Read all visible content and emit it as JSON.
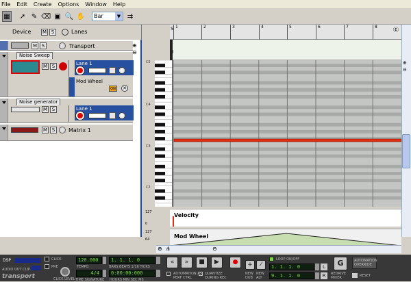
{
  "menu": [
    "File",
    "Edit",
    "Create",
    "Options",
    "Window",
    "Help"
  ],
  "toolbar": {
    "snap_value": "Bar"
  },
  "devhead": {
    "device_label": "Device",
    "m": "M",
    "s": "S",
    "lanes_label": "Lanes"
  },
  "tracks": {
    "transport": {
      "name": "Transport"
    },
    "noise_sweep": {
      "tab": "Noise Sweep",
      "lane": "Lane 1",
      "mod": "Mod Wheel",
      "on": "ON"
    },
    "noise_gen": {
      "tab": "Noise generator",
      "lane": "Lane 1"
    },
    "matrix": {
      "name": "Matrix 1"
    }
  },
  "ruler": {
    "bars": [
      "1",
      "2",
      "3",
      "4",
      "5",
      "6",
      "7",
      "8"
    ]
  },
  "keys": {
    "labels": [
      "C5",
      "C4",
      "C3",
      "C2"
    ]
  },
  "velocity": {
    "label": "Velocity",
    "max": "127",
    "min": "0"
  },
  "modwheel": {
    "label": "Mod Wheel",
    "max": "127",
    "mid": "64"
  },
  "transport": {
    "dsp": "DSP",
    "audio_out": "AUDIO OUT CLIP",
    "brand": "transport",
    "click": "CLICK",
    "pre": "PRE",
    "click_level": "CLICK LEVEL",
    "tempo": "120.000",
    "tempo_label": "TEMPO",
    "sig": "4/4",
    "sig_label": "TIME SIGNATURE",
    "pos": "1.  1.  1.   0",
    "pos_label": "BARS BEATS 1/16 TICKS",
    "time": "0:00:00:000",
    "time_label": "HOURS  MIN  SEC  MS",
    "auto_perf": "AUTOMATION AS PERF CTRL",
    "quantize": "QUANTIZE DURING REC",
    "new_dub": "NEW DUB",
    "new_alt": "NEW ALT",
    "loop": "LOOP ON/OFF",
    "loop_l": "1.  1.  1.   0",
    "loop_r": "9.  1.  1.   0",
    "l": "L",
    "r": "R",
    "redrum": "REDRIVE MIXER",
    "g": "G",
    "override": "AUTOMATION OVERRIDE",
    "reset": "RESET"
  },
  "colors": {
    "accent": "#1c48a0",
    "note": "#e03010",
    "lcd": "#7fd44a"
  }
}
